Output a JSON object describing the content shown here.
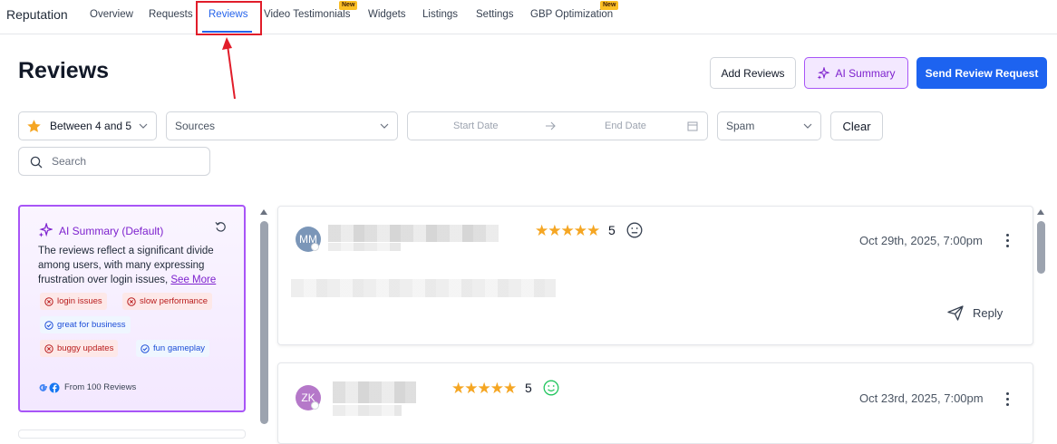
{
  "nav": {
    "brand": "Reputation",
    "tabs": [
      "Overview",
      "Requests",
      "Reviews",
      "Video Testimonials",
      "Widgets",
      "Listings",
      "Settings",
      "GBP Optimization"
    ],
    "badge_new": "New"
  },
  "header": {
    "title": "Reviews",
    "add_reviews": "Add Reviews",
    "ai_summary": "AI Summary",
    "send_request": "Send Review Request"
  },
  "filters": {
    "rating": "Between 4 and 5",
    "sources_placeholder": "Sources",
    "start_date": "Start Date",
    "end_date": "End Date",
    "spam": "Spam",
    "clear": "Clear",
    "search_placeholder": "Search"
  },
  "ai_card": {
    "title": "AI Summary (Default)",
    "summary": "The reviews reflect a significant divide among users, with many expressing frustration over login issues,",
    "see_more": "See More",
    "tags": [
      {
        "label": "login issues",
        "kind": "negative"
      },
      {
        "label": "slow performance",
        "kind": "negative"
      },
      {
        "label": "great for business",
        "kind": "positive"
      },
      {
        "label": "buggy updates",
        "kind": "negative"
      },
      {
        "label": "fun gameplay",
        "kind": "positive"
      }
    ],
    "footer": "From 100 Reviews"
  },
  "reviews": [
    {
      "initials": "MM",
      "rating": "5",
      "date": "Oct 29th, 2025, 7:00pm",
      "reply": "Reply",
      "sentiment": "neutral",
      "avatar_color": "#7b96b8"
    },
    {
      "initials": "ZK",
      "rating": "5",
      "date": "Oct 23rd, 2025, 7:00pm",
      "sentiment": "positive",
      "avatar_color": "#b578c9"
    }
  ],
  "colors": {
    "accent": "#2563eb",
    "ai_purple": "#7e22ce",
    "primary_button": "#1d63f0",
    "star": "#f5a623",
    "highlight": "#e11d2a"
  }
}
